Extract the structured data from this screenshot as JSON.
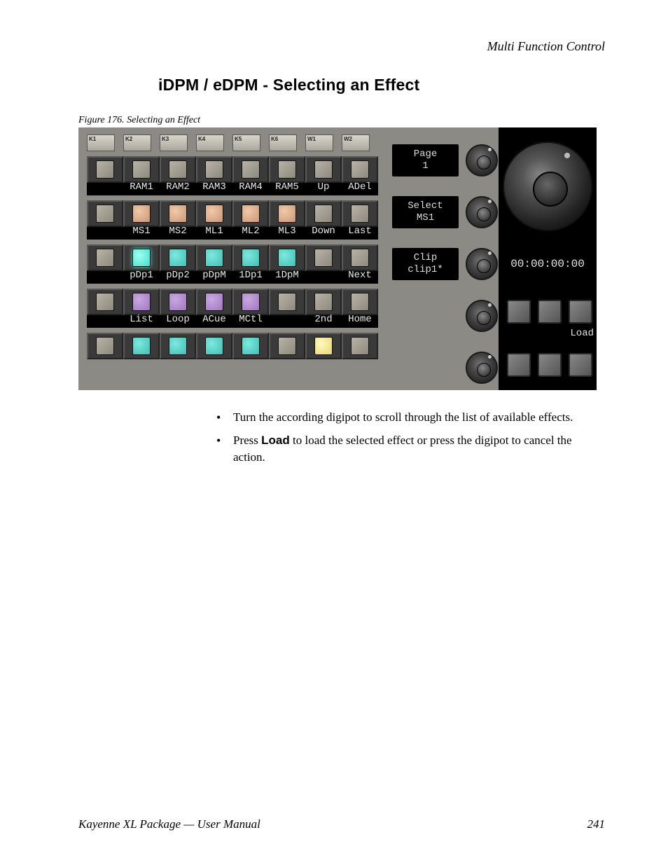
{
  "header": {
    "category": "Multi Function Control"
  },
  "section": {
    "title": "iDPM / eDPM - Selecting an Effect"
  },
  "figure": {
    "caption": "Figure 176.  Selecting an Effect"
  },
  "top_small": [
    "K1",
    "K2",
    "K3",
    "K4",
    "K5",
    "K6",
    "W1",
    "W2"
  ],
  "rows": {
    "r1_labels": [
      "RAM1",
      "RAM2",
      "RAM3",
      "RAM4",
      "RAM5",
      "Up",
      "ADel"
    ],
    "r2_labels": [
      "MS1",
      "MS2",
      "ML1",
      "ML2",
      "ML3",
      "Down",
      "Last"
    ],
    "r3_labels": [
      "pDp1",
      "pDp2",
      "pDpM",
      "1Dp1",
      "1DpM",
      "",
      "Next"
    ],
    "r4_labels": [
      "List",
      "Loop",
      "ACue",
      "MCtl",
      "",
      "2nd",
      "Home"
    ]
  },
  "knobs": {
    "k1": {
      "line1": "Page",
      "line2": "1"
    },
    "k2": {
      "line1": "Select",
      "line2": "MS1"
    },
    "k3": {
      "line1": "Clip",
      "line2": "clip1*"
    }
  },
  "timecode": "00:00:00:00",
  "load_label": "Load",
  "bullets": {
    "b1": "Turn the according digipot to scroll through the list of available effects.",
    "b2a": "Press ",
    "b2_bold": "Load",
    "b2b": " to load the selected effect or press the digipot to cancel the action."
  },
  "footer": {
    "left": "Kayenne XL Package  —  User Manual",
    "page": "241"
  }
}
